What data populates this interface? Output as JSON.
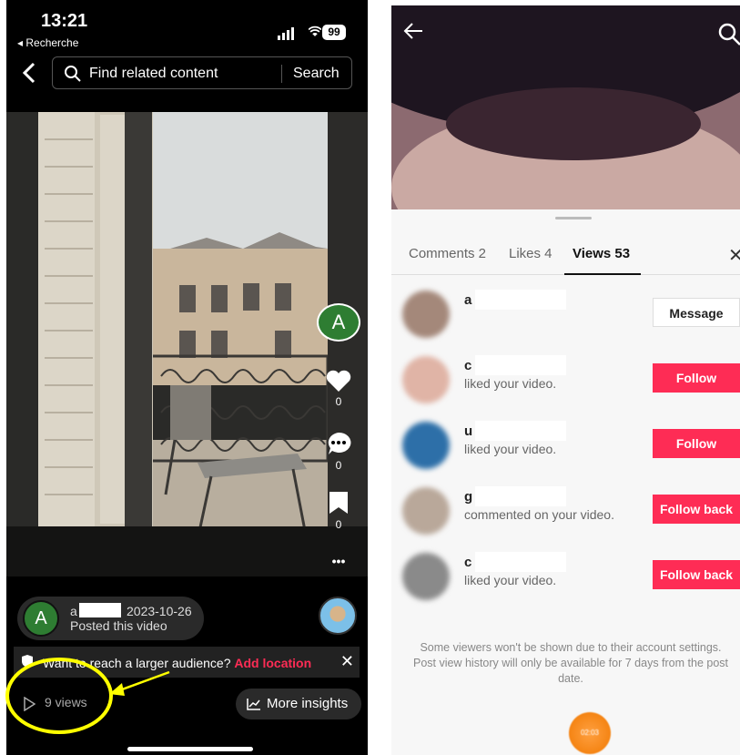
{
  "left_phone": {
    "status": {
      "time": "13:21",
      "back_app": "◂ Recherche",
      "battery": "99"
    },
    "search": {
      "placeholder": "Find related content",
      "button": "Search"
    },
    "rail": {
      "avatar_letter": "A",
      "likes": "0",
      "comments": "0",
      "saves": "0",
      "more": "•••"
    },
    "post": {
      "avatar_letter": "A",
      "username": "a",
      "date": "2023-10-26",
      "caption": "Posted this video"
    },
    "promo": {
      "text": "Want to reach a larger audience?",
      "link": "Add location",
      "close": "✕"
    },
    "views": "9 views",
    "insights": "More insights"
  },
  "right_phone": {
    "tabs": [
      {
        "label": "Comments 2"
      },
      {
        "label": "Likes 4"
      },
      {
        "label": "Views 53"
      }
    ],
    "close": "✕",
    "viewers": [
      {
        "name": "a",
        "activity": "",
        "button": "Message",
        "style": "outline",
        "avatar_color": "#a4887a"
      },
      {
        "name": "c",
        "activity": "liked your video.",
        "button": "Follow",
        "style": "red",
        "avatar_color": "#e0b4a6"
      },
      {
        "name": "u",
        "activity": "liked your video.",
        "button": "Follow",
        "style": "red",
        "avatar_color": "#2d6fa8"
      },
      {
        "name": "g",
        "activity": "commented on your video.",
        "button": "Follow back",
        "style": "red",
        "avatar_color": "#b9a89a"
      },
      {
        "name": "c",
        "activity": "liked your video.",
        "button": "Follow back",
        "style": "red",
        "avatar_color": "#8a8a8a"
      }
    ],
    "note": "Some viewers won't be shown due to their account settings. Post view history will only be available for 7 days from the post date.",
    "float_label": "02:03"
  },
  "colors": {
    "accent_red": "#fe2c55",
    "highlight_yellow": "#ffff00",
    "avatar_green": "#2e7d32"
  }
}
